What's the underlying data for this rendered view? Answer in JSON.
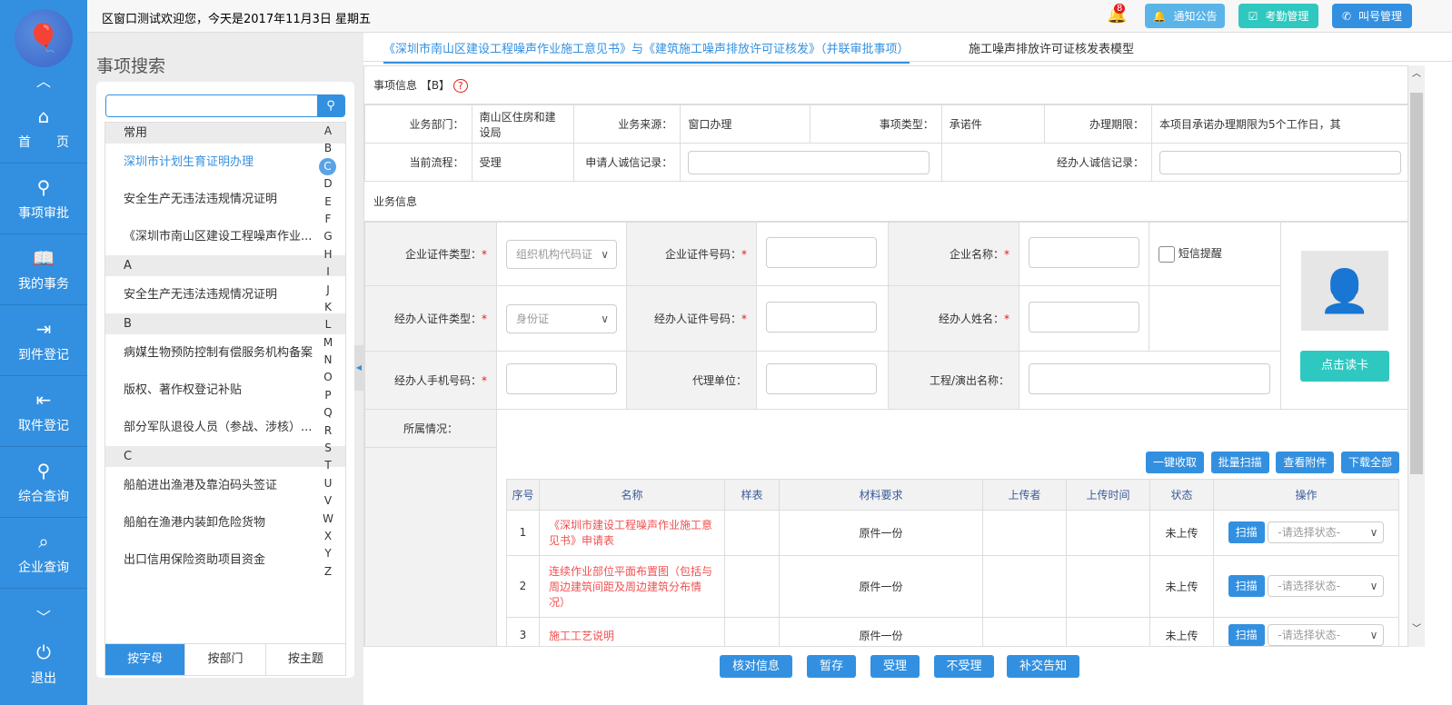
{
  "nav": {
    "items": [
      "首　　页",
      "事项审批",
      "我的事务",
      "到件登记",
      "取件登记",
      "综合查询",
      "企业查询"
    ],
    "logout": "退出"
  },
  "header": {
    "welcome": "区窗口测试欢迎您，今天是2017年11月3日 星期五",
    "notifications": "8",
    "buttons": [
      "通知公告",
      "考勤管理",
      "叫号管理"
    ],
    "colors": [
      "#5ab4e8",
      "#2fc8c0",
      "#3390e0"
    ]
  },
  "search": {
    "title": "事项搜索",
    "placeholder": "",
    "sections": [
      {
        "head": "常用",
        "items": [
          "深圳市计划生育证明办理",
          "安全生产无违法违规情况证明",
          "《深圳市南山区建设工程噪声作业..."
        ]
      },
      {
        "head": "A",
        "items": [
          "安全生产无违法违规情况证明"
        ]
      },
      {
        "head": "B",
        "items": [
          "病媒生物预防控制有偿服务机构备案",
          "版权、著作权登记补贴",
          "部分军队退役人员（参战、涉核）..."
        ]
      },
      {
        "head": "C",
        "items": [
          "船舶进出渔港及靠泊码头签证",
          "船舶在渔港内装卸危险货物",
          "出口信用保险资助项目资金"
        ]
      }
    ],
    "letters": [
      "A",
      "B",
      "C",
      "D",
      "E",
      "F",
      "G",
      "H",
      "I",
      "J",
      "K",
      "L",
      "M",
      "N",
      "O",
      "P",
      "Q",
      "R",
      "S",
      "T",
      "U",
      "V",
      "W",
      "X",
      "Y",
      "Z"
    ],
    "active_letter": "C",
    "tabs": [
      "按字母",
      "按部门",
      "按主题"
    ]
  },
  "tabs": [
    "《深圳市南山区建设工程噪声作业施工意见书》与《建筑施工噪声排放许可证核发》（并联审批事项）",
    "施工噪声排放许可证核发表模型"
  ],
  "info": {
    "title": "事项信息 【B】",
    "dept_label": "业务部门：",
    "dept": "南山区住房和建设局",
    "source_label": "业务来源：",
    "source": "窗口办理",
    "type_label": "事项类型：",
    "type": "承诺件",
    "period_label": "办理期限：",
    "period": "本项目承诺办理期限为5个工作日，其",
    "flow_label": "当前流程：",
    "flow": "受理",
    "applicant_credit": "申请人诚信记录：",
    "agent_credit": "经办人诚信记录："
  },
  "biz": {
    "title": "业务信息",
    "cert_type": "企业证件类型：",
    "cert_type_val": "组织机构代码证",
    "cert_no": "企业证件号码：",
    "company": "企业名称：",
    "sms": "短信提醒",
    "agent_cert_type": "经办人证件类型：",
    "agent_cert_val": "身份证",
    "agent_cert_no": "经办人证件号码：",
    "agent_name": "经办人姓名：",
    "agent_phone": "经办人手机号码：",
    "agency": "代理单位：",
    "project": "工程/演出名称：",
    "read_card": "点击读卡",
    "belong": "所属情况："
  },
  "materials": {
    "buttons": [
      "一键收取",
      "批量扫描",
      "查看附件",
      "下载全部"
    ],
    "headers": [
      "序号",
      "名称",
      "样表",
      "材料要求",
      "上传者",
      "上传时间",
      "状态",
      "操作"
    ],
    "rows": [
      {
        "no": "1",
        "name": "《深圳市建设工程噪声作业施工意见书》申请表",
        "req": "原件一份",
        "status": "未上传",
        "scan": "扫描",
        "select": "-请选择状态-"
      },
      {
        "no": "2",
        "name": "连续作业部位平面布置图（包括与周边建筑间距及周边建筑分布情况）",
        "req": "原件一份",
        "status": "未上传",
        "scan": "扫描",
        "select": "-请选择状态-"
      },
      {
        "no": "3",
        "name": "施工工艺说明",
        "req": "原件一份",
        "status": "未上传",
        "scan": "扫描",
        "select": "-请选择状态-"
      }
    ]
  },
  "footer": [
    "核对信息",
    "暂存",
    "受理",
    "不受理",
    "补交告知"
  ]
}
